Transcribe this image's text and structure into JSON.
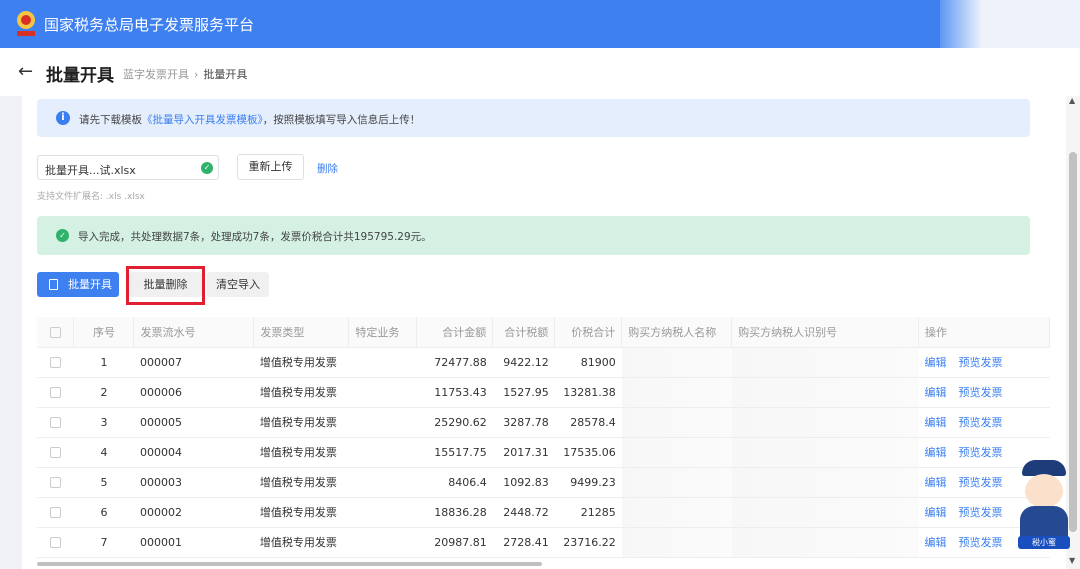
{
  "app": {
    "title": "国家税务总局电子发票服务平台"
  },
  "titlebar": {
    "back_icon": "←",
    "title": "批量开具",
    "breadcrumb": [
      "蓝字发票开具",
      "批量开具"
    ],
    "breadcrumb_sep": "›"
  },
  "info": {
    "prefix": "请先下载模板",
    "link": "《批量导入开具发票模板》",
    "suffix": "，按照模板填写导入信息后上传！"
  },
  "upload": {
    "file_name": "批量开具...试.xlsx",
    "reupload_label": "重新上传",
    "delete_label": "删除",
    "ext_hint": "支持文件扩展名: .xls .xlsx"
  },
  "success": {
    "message": "导入完成，共处理数据7条，处理成功7条，发票价税合计共195795.29元。"
  },
  "toolbar": {
    "batch_issue": "批量开具",
    "batch_delete": "批量删除",
    "clear_import": "清空导入"
  },
  "table": {
    "headers": [
      "序号",
      "发票流水号",
      "发票类型",
      "特定业务",
      "合计金额",
      "合计税额",
      "价税合计",
      "购买方纳税人名称",
      "购买方纳税人识别号",
      "操作"
    ],
    "rows": [
      {
        "idx": "1",
        "serial": "000007",
        "type": "增值税专用发票",
        "amount": "72477.88",
        "tax": "9422.12",
        "total": "81900"
      },
      {
        "idx": "2",
        "serial": "000006",
        "type": "增值税专用发票",
        "amount": "11753.43",
        "tax": "1527.95",
        "total": "13281.38"
      },
      {
        "idx": "3",
        "serial": "000005",
        "type": "增值税专用发票",
        "amount": "25290.62",
        "tax": "3287.78",
        "total": "28578.4"
      },
      {
        "idx": "4",
        "serial": "000004",
        "type": "增值税专用发票",
        "amount": "15517.75",
        "tax": "2017.31",
        "total": "17535.06"
      },
      {
        "idx": "5",
        "serial": "000003",
        "type": "增值税专用发票",
        "amount": "8406.4",
        "tax": "1092.83",
        "total": "9499.23"
      },
      {
        "idx": "6",
        "serial": "000002",
        "type": "增值税专用发票",
        "amount": "18836.28",
        "tax": "2448.72",
        "total": "21285"
      },
      {
        "idx": "7",
        "serial": "000001",
        "type": "增值税专用发票",
        "amount": "20987.81",
        "tax": "2728.41",
        "total": "23716.22"
      }
    ],
    "op_edit": "编辑",
    "op_preview": "预览发票"
  },
  "assistant": {
    "tag": "税小蜜"
  },
  "colors": {
    "primary": "#3f80f0",
    "success": "#2fb36b",
    "highlight": "#e02030"
  }
}
